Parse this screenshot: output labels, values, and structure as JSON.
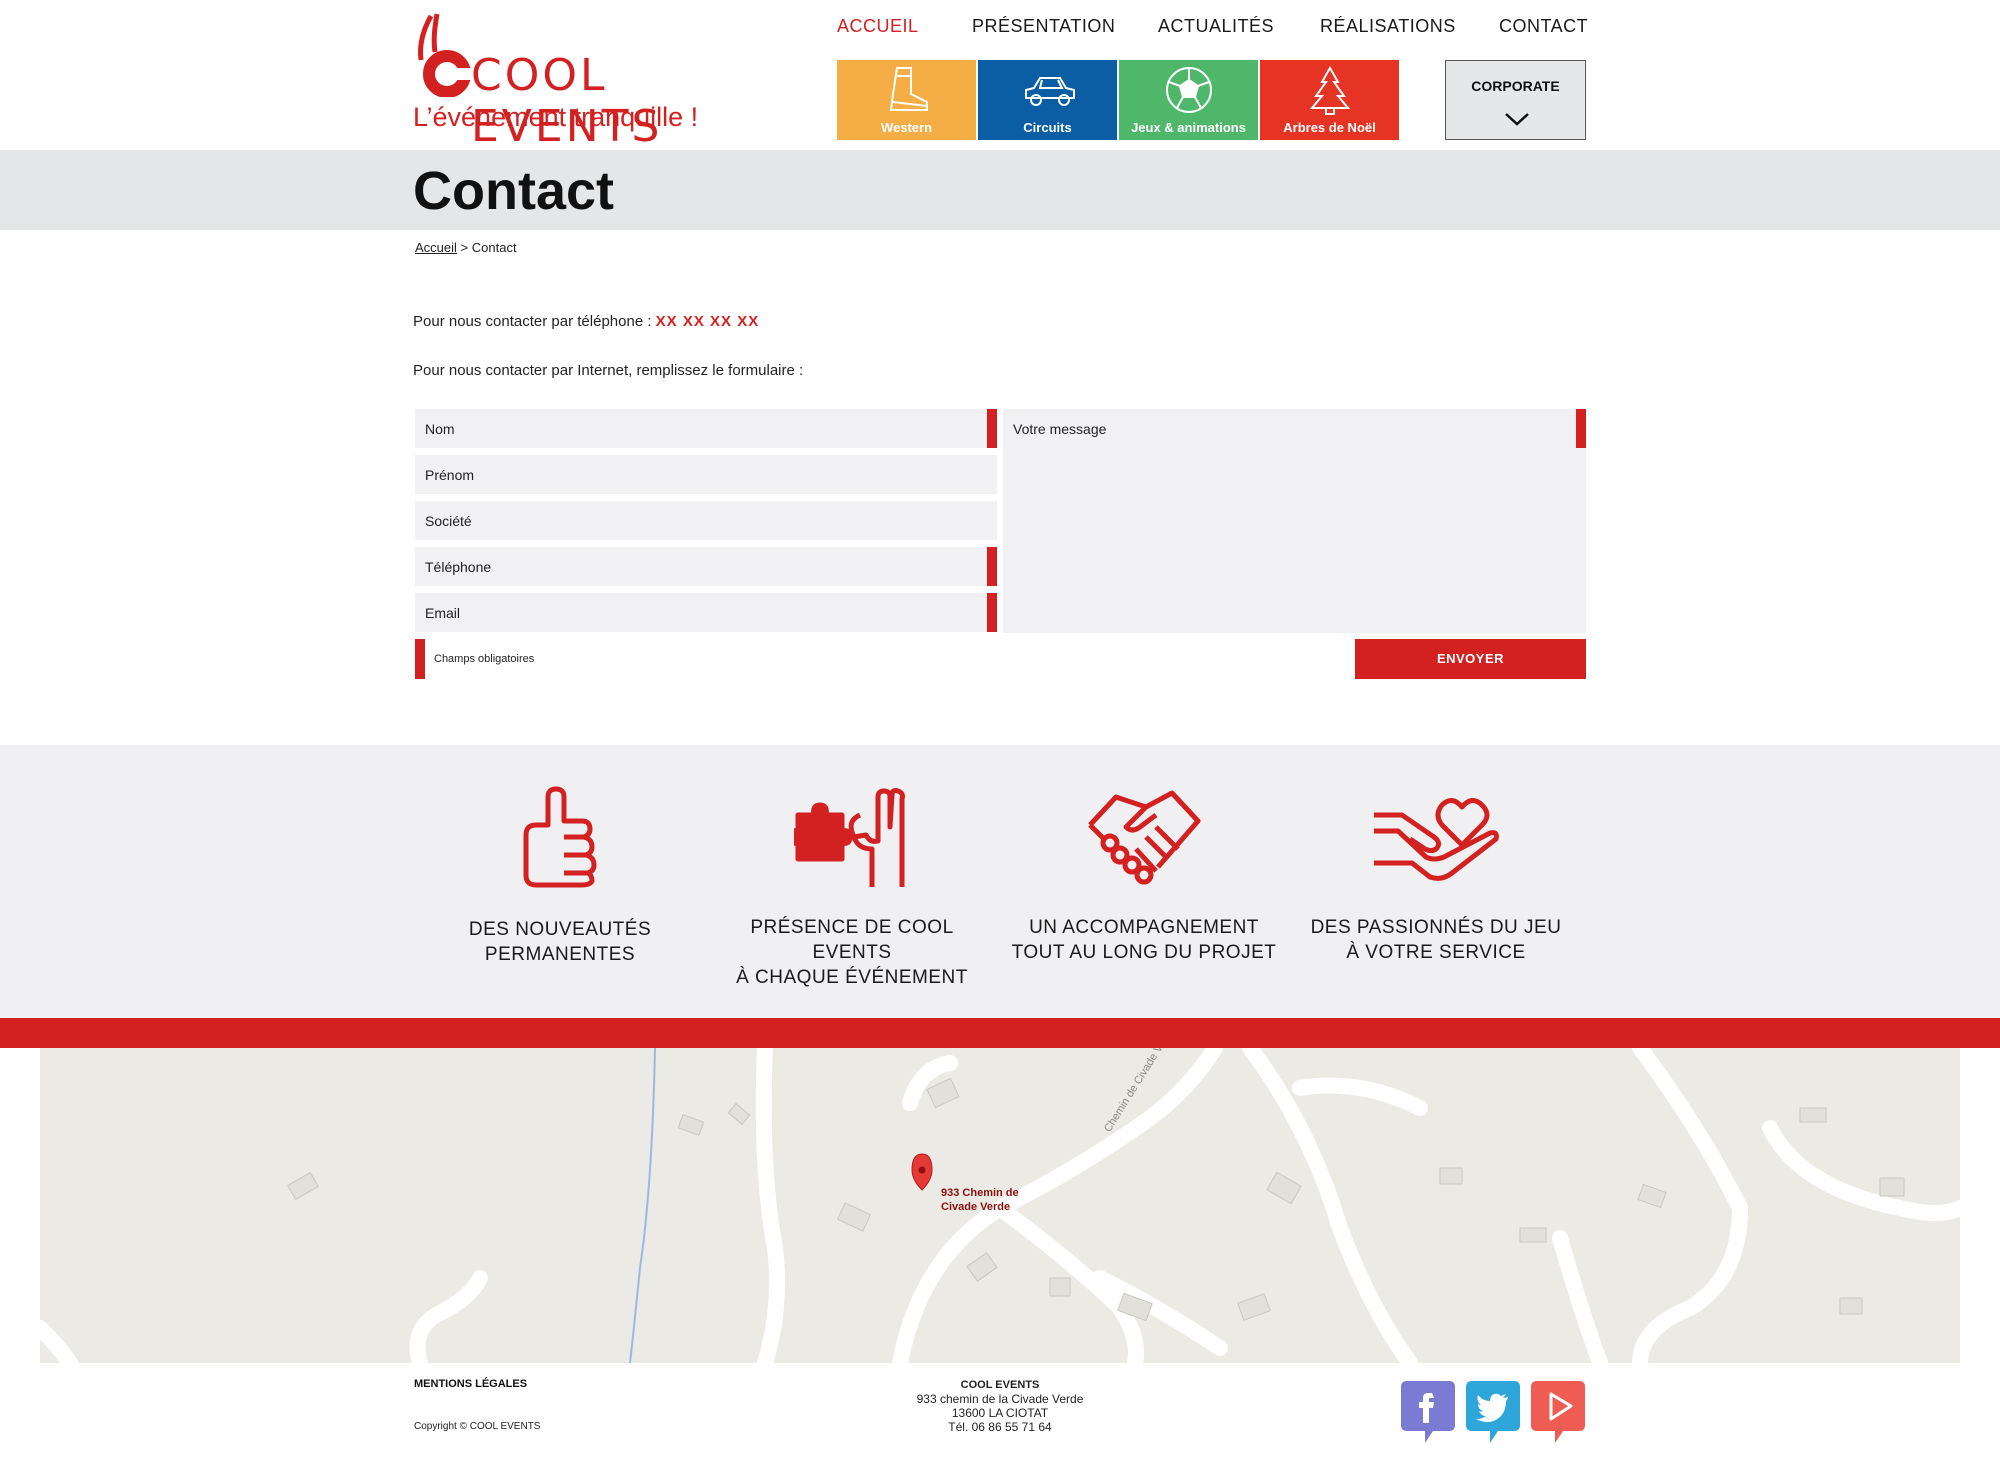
{
  "header": {
    "logo_text": "COOL EVENTS",
    "tagline": "L’événement tranquille !",
    "nav": [
      "ACCUEIL",
      "PRÉSENTATION",
      "ACTUALITÉS",
      "RÉALISATIONS",
      "CONTACT"
    ],
    "active_nav": "ACCUEIL",
    "categories": [
      {
        "label": "Western",
        "color": "#f5ad45",
        "icon": "boot-icon"
      },
      {
        "label": "Circuits",
        "color": "#0b5ea3",
        "icon": "car-icon"
      },
      {
        "label": "Jeux & animations",
        "color": "#4fb76a",
        "icon": "soccer-ball-icon"
      },
      {
        "label": "Arbres de Noël",
        "color": "#e53324",
        "icon": "christmas-tree-icon"
      }
    ],
    "corporate_label": "CORPORATE"
  },
  "page": {
    "title": "Contact",
    "breadcrumb_home": "Accueil",
    "breadcrumb_sep": ">",
    "breadcrumb_current": "Contact",
    "phone_intro": "Pour nous contacter par téléphone :",
    "phone": "XX XX XX XX",
    "form_intro": "Pour nous contacter par Internet, remplissez le formulaire :"
  },
  "form": {
    "nom": "Nom",
    "prenom": "Prénom",
    "societe": "Société",
    "telephone": "Téléphone",
    "email": "Email",
    "message": "Votre message",
    "required_note": "Champs obligatoires",
    "submit": "ENVOYER"
  },
  "features": [
    {
      "line1": "DES NOUVEAUTÉS",
      "line2": "PERMANENTES",
      "icon": "thumbs-up-icon"
    },
    {
      "line1": "PRÉSENCE DE COOL EVENTS",
      "line2": "À CHAQUE ÉVÉNEMENT",
      "icon": "puzzle-hand-icon"
    },
    {
      "line1": "UN ACCOMPAGNEMENT",
      "line2": "TOUT AU LONG DU PROJET",
      "icon": "handshake-icon"
    },
    {
      "line1": "DES PASSIONNÉS DU JEU",
      "line2": "À VOTRE SERVICE",
      "icon": "heart-hand-icon"
    }
  ],
  "map": {
    "marker_line1": "933 Chemin de",
    "marker_line2": "Civade Verde",
    "road_name": "Chemin de Civade Verde"
  },
  "footer": {
    "mentions": "MENTIONS LÉGALES",
    "copyright": "Copyright © COOL EVENTS",
    "company_name": "COOL EVENTS",
    "address1": "933 chemin de la Civade Verde",
    "address2": "13600 LA CIOTAT",
    "tel": "Tél. 06 86 55 71 64",
    "social": [
      "facebook-icon",
      "twitter-icon",
      "youtube-icon"
    ]
  },
  "colors": {
    "brand_red": "#d32020",
    "band_grey": "#e5e6e8",
    "field_bg": "#f1f1f3"
  }
}
